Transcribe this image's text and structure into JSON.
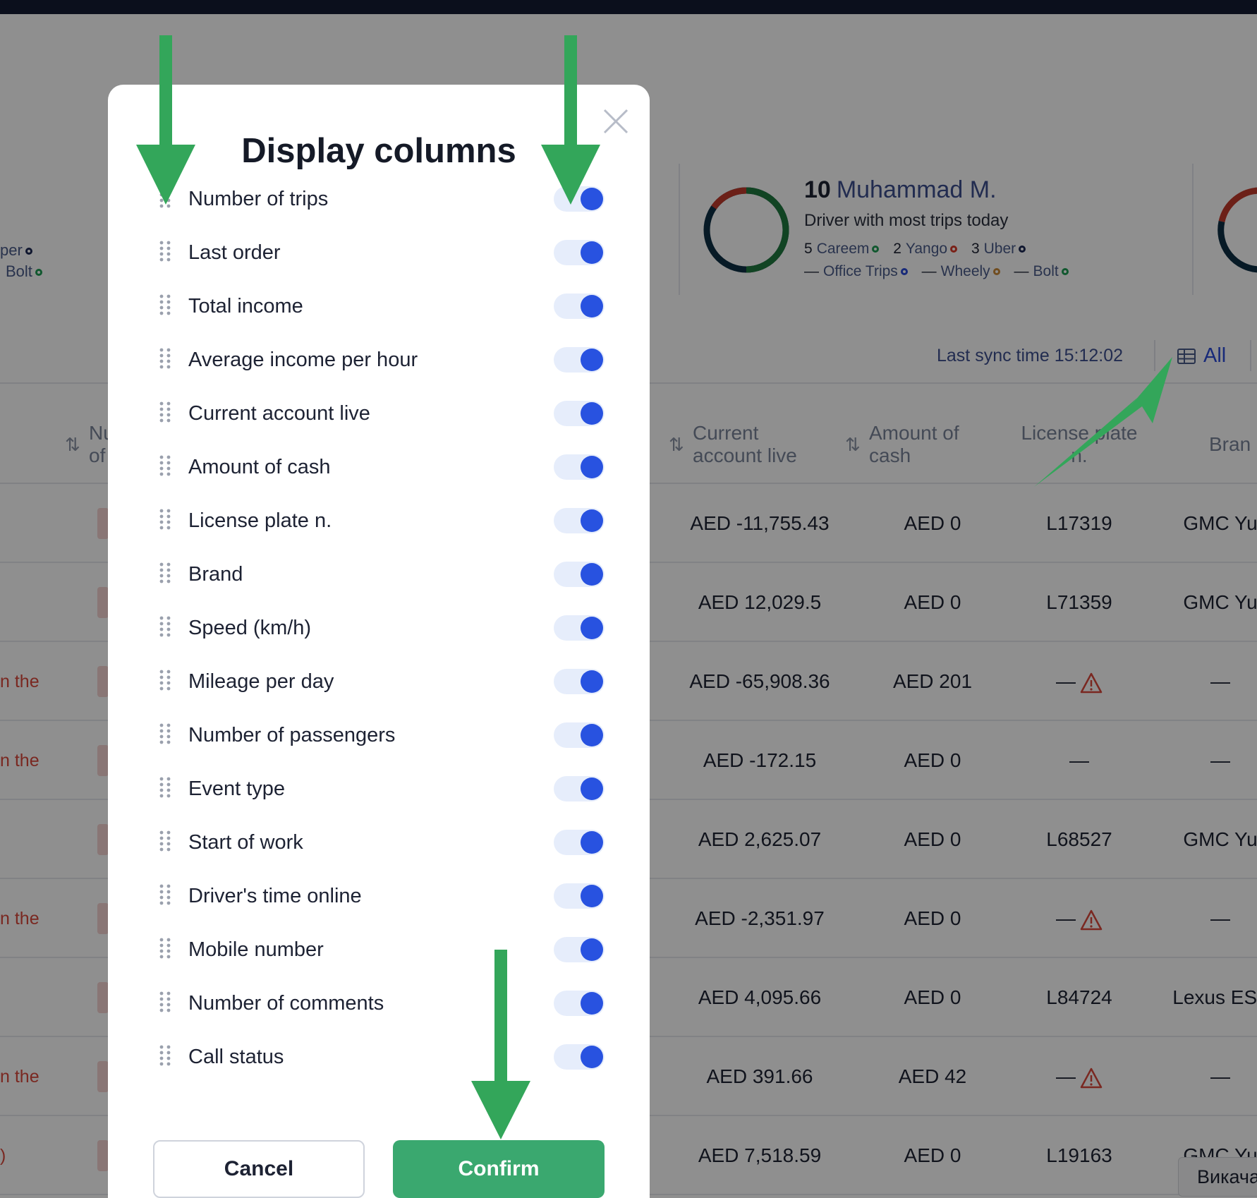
{
  "stats": {
    "left_partial_legend_row1": "per",
    "left_partial_legend_row2": "Bolt",
    "top_driver": {
      "rank": "10",
      "name": "Muhammad M.",
      "subtitle": "Driver with most trips today",
      "counts": [
        {
          "count": "5",
          "platform": "Careem",
          "dot": "green"
        },
        {
          "count": "2",
          "platform": "Yango",
          "dot": "red"
        },
        {
          "count": "3",
          "platform": "Uber",
          "dot": "navy"
        }
      ],
      "zero_counts": [
        {
          "count": "—",
          "platform": "Office Trips",
          "dot": "blue"
        },
        {
          "count": "—",
          "platform": "Wheely",
          "dot": "orange"
        },
        {
          "count": "—",
          "platform": "Bolt",
          "dot": "green"
        }
      ]
    }
  },
  "toolbar": {
    "last_sync": "Last sync time 15:12:02",
    "columns_button": "All"
  },
  "table": {
    "headers": {
      "trips_partial_1": "Nu",
      "trips_partial_2": "of",
      "current_account": "Current account live",
      "amount_cash": "Amount of cash",
      "license_plate": "License plate n.",
      "brand": "Bran"
    },
    "rows": [
      {
        "left_note": "",
        "account": "AED -11,755.43",
        "cash": "AED 0",
        "plate": "L17319",
        "plate_warning": false,
        "brand": "GMC Yu"
      },
      {
        "left_note": "",
        "account": "AED 12,029.5",
        "cash": "AED 0",
        "plate": "L71359",
        "plate_warning": false,
        "brand": "GMC Yu"
      },
      {
        "left_note": "n the",
        "account": "AED -65,908.36",
        "cash": "AED 201",
        "plate": "—",
        "plate_warning": true,
        "brand": "—"
      },
      {
        "left_note": "n the",
        "account": "AED -172.15",
        "cash": "AED 0",
        "plate": "—",
        "plate_warning": false,
        "brand": "—"
      },
      {
        "left_note": "",
        "account": "AED 2,625.07",
        "cash": "AED 0",
        "plate": "L68527",
        "plate_warning": false,
        "brand": "GMC Yu"
      },
      {
        "left_note": "n the",
        "account": "AED -2,351.97",
        "cash": "AED 0",
        "plate": "—",
        "plate_warning": true,
        "brand": "—"
      },
      {
        "left_note": "",
        "account": "AED 4,095.66",
        "cash": "AED 0",
        "plate": "L84724",
        "plate_warning": false,
        "brand": "Lexus ES3"
      },
      {
        "left_note": "n the",
        "account": "AED 391.66",
        "cash": "AED 42",
        "plate": "—",
        "plate_warning": true,
        "brand": "—"
      },
      {
        "left_note": ")",
        "account": "AED 7,518.59",
        "cash": "AED 0",
        "plate": "L19163",
        "plate_warning": false,
        "brand": "GMC Yu"
      }
    ]
  },
  "tooltip": "Викача",
  "modal": {
    "title": "Display columns",
    "columns": [
      {
        "label": "Number of trips",
        "enabled": true
      },
      {
        "label": "Last order",
        "enabled": true
      },
      {
        "label": "Total income",
        "enabled": true
      },
      {
        "label": "Average income per hour",
        "enabled": true
      },
      {
        "label": "Current account live",
        "enabled": true
      },
      {
        "label": "Amount of cash",
        "enabled": true
      },
      {
        "label": "License plate n.",
        "enabled": true
      },
      {
        "label": "Brand",
        "enabled": true
      },
      {
        "label": "Speed (km/h)",
        "enabled": true
      },
      {
        "label": "Mileage per day",
        "enabled": true
      },
      {
        "label": "Number of passengers",
        "enabled": true
      },
      {
        "label": "Event type",
        "enabled": true
      },
      {
        "label": "Start of work",
        "enabled": true
      },
      {
        "label": "Driver's time online",
        "enabled": true
      },
      {
        "label": "Mobile number",
        "enabled": true
      },
      {
        "label": "Number of comments",
        "enabled": true
      },
      {
        "label": "Call status",
        "enabled": true
      }
    ],
    "cancel_label": "Cancel",
    "confirm_label": "Confirm"
  },
  "colors": {
    "accent_blue": "#2852e0",
    "confirm_green": "#3aa86f",
    "annotation_arrow": "#33a65a",
    "warning_red": "#d9483b"
  }
}
